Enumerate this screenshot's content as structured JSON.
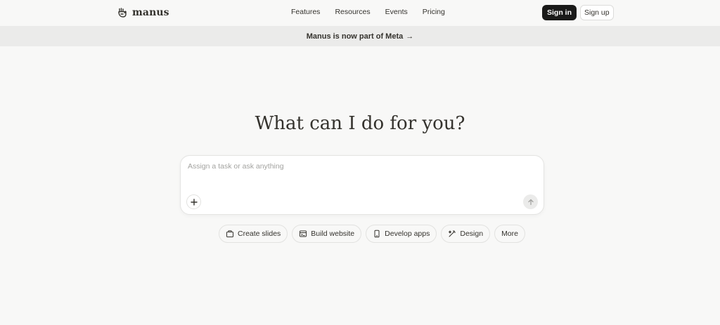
{
  "header": {
    "logo_text": "manus",
    "nav": [
      "Features",
      "Resources",
      "Events",
      "Pricing"
    ],
    "sign_in_label": "Sign in",
    "sign_up_label": "Sign up"
  },
  "banner": {
    "text": "Manus is now part of Meta",
    "arrow": "→"
  },
  "main": {
    "headline": "What can I do for you?",
    "composer": {
      "placeholder": "Assign a task or ask anything",
      "value": ""
    },
    "chips": [
      {
        "label": "Create slides",
        "icon": "slides-icon"
      },
      {
        "label": "Build website",
        "icon": "browser-window-icon"
      },
      {
        "label": "Develop apps",
        "icon": "mobile-phone-icon"
      },
      {
        "label": "Design",
        "icon": "magic-wand-icon"
      },
      {
        "label": "More",
        "icon": ""
      }
    ]
  },
  "colors": {
    "background": "#f8f8f7",
    "banner": "#ebebea",
    "primary_button": "#1a1a19",
    "text": "#34322d"
  }
}
